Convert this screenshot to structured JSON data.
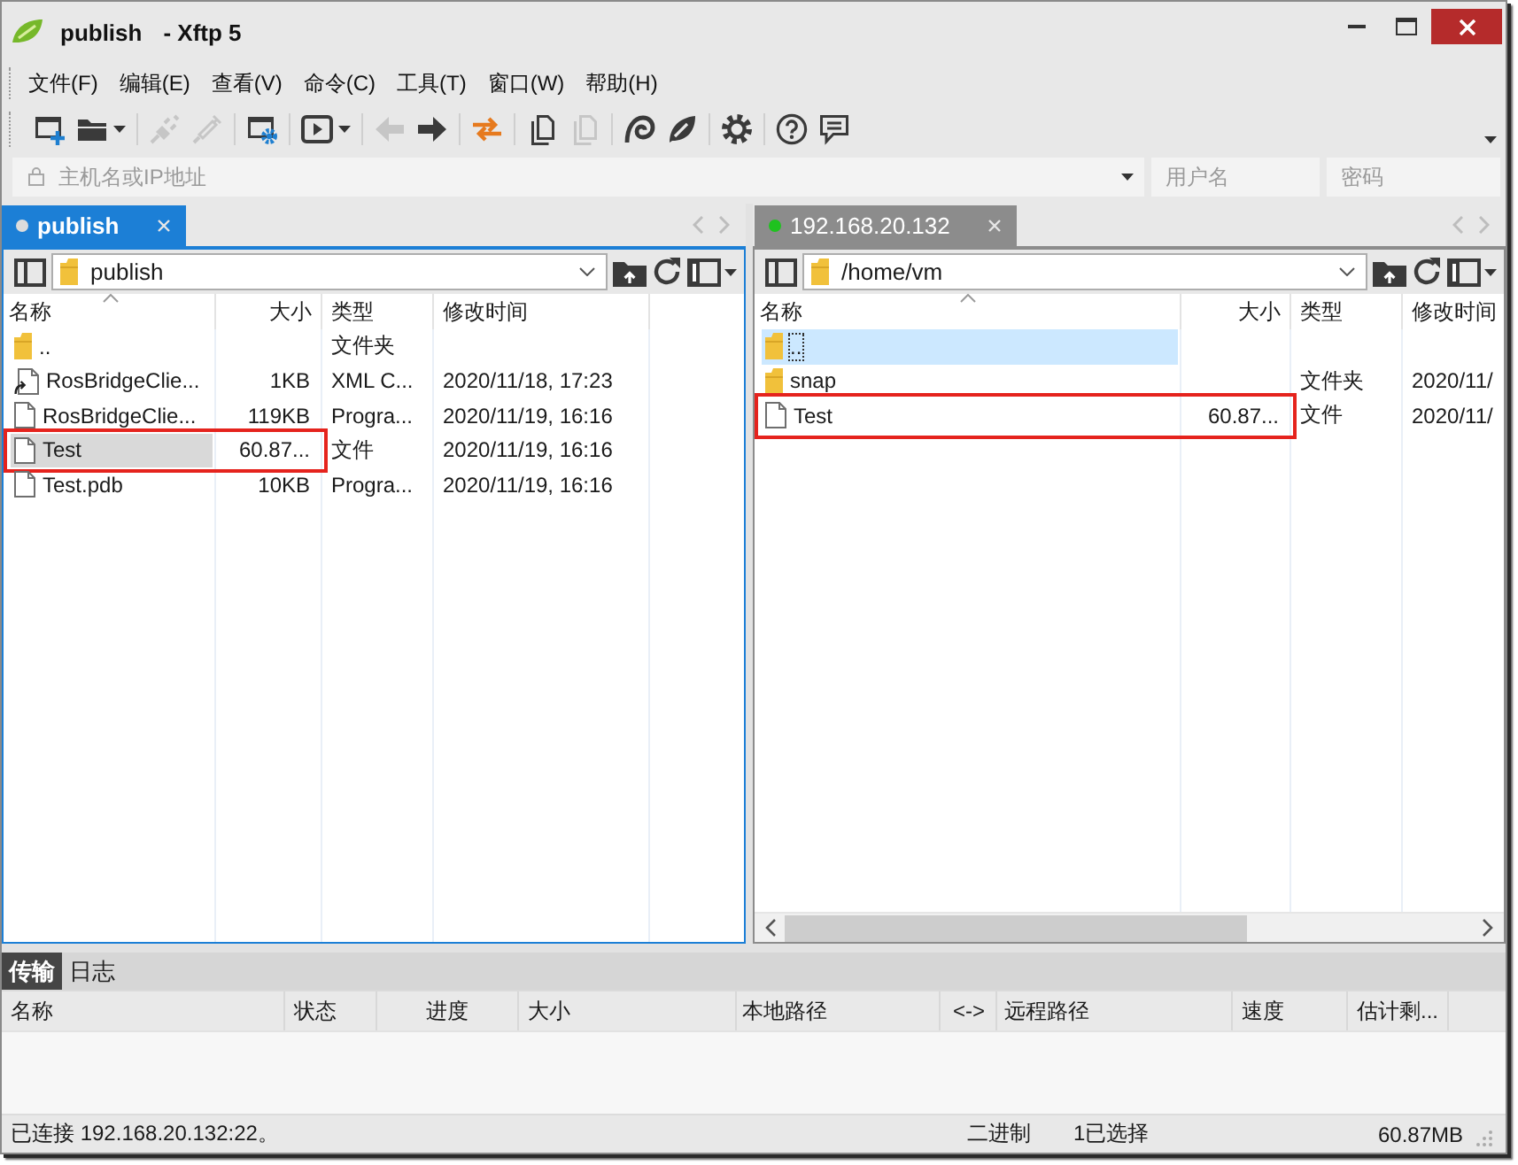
{
  "window": {
    "title": "publish",
    "app_name": "- Xftp 5"
  },
  "menu": [
    "文件(F)",
    "编辑(E)",
    "查看(V)",
    "命令(C)",
    "工具(T)",
    "窗口(W)",
    "帮助(H)"
  ],
  "toolbar": [
    [
      {
        "kind": "new-session",
        "disabled": false,
        "dropdown": false
      },
      {
        "kind": "open",
        "disabled": false,
        "dropdown": true
      }
    ],
    [
      {
        "kind": "connect",
        "disabled": true,
        "dropdown": false
      },
      {
        "kind": "disconnect",
        "disabled": true,
        "dropdown": false
      }
    ],
    [
      {
        "kind": "properties",
        "disabled": false,
        "dropdown": false
      }
    ],
    [
      {
        "kind": "run",
        "disabled": false,
        "dropdown": true
      }
    ],
    [
      {
        "kind": "back",
        "disabled": true,
        "dropdown": false
      },
      {
        "kind": "forward",
        "disabled": false,
        "dropdown": false
      }
    ],
    [
      {
        "kind": "transfer",
        "disabled": false,
        "dropdown": false
      }
    ],
    [
      {
        "kind": "copy",
        "disabled": false,
        "dropdown": false
      },
      {
        "kind": "paste",
        "disabled": true,
        "dropdown": false
      }
    ],
    [
      {
        "kind": "shell",
        "disabled": false,
        "dropdown": false
      },
      {
        "kind": "xftp",
        "disabled": false,
        "dropdown": false
      }
    ],
    [
      {
        "kind": "settings",
        "disabled": false,
        "dropdown": false
      }
    ],
    [
      {
        "kind": "help",
        "disabled": false,
        "dropdown": false
      },
      {
        "kind": "feedback",
        "disabled": false,
        "dropdown": false
      }
    ]
  ],
  "address_bar": {
    "host_placeholder": "主机名或IP地址",
    "user_placeholder": "用户名",
    "password_placeholder": "密码"
  },
  "panes": [
    {
      "focused": true,
      "tabs": [
        {
          "label": "publish",
          "selected": true,
          "connected": false
        }
      ],
      "path": "publish",
      "horizontal_scrollbar": false,
      "columns": [
        "名称",
        "大小",
        "类型",
        "修改时间"
      ],
      "rows": [
        {
          "kind": "folder",
          "name": "..",
          "type": "文件夹",
          "selected": false,
          "annotated": false
        },
        {
          "kind": "linked-file",
          "name": "RosBridgeClie...",
          "size": "1KB",
          "type": "XML C...",
          "modified": "2020/11/18, 17:23",
          "selected": false,
          "annotated": false
        },
        {
          "kind": "file",
          "name": "RosBridgeClie...",
          "size": "119KB",
          "type": "Progra...",
          "modified": "2020/11/19, 16:16",
          "selected": false,
          "annotated": false
        },
        {
          "kind": "file",
          "name": "Test",
          "size": "60.87...",
          "type": "文件",
          "modified": "2020/11/19, 16:16",
          "selected": true,
          "annotated": true
        },
        {
          "kind": "file",
          "name": "Test.pdb",
          "size": "10KB",
          "type": "Progra...",
          "modified": "2020/11/19, 16:16",
          "selected": false,
          "annotated": false
        }
      ]
    },
    {
      "focused": false,
      "tabs": [
        {
          "label": "192.168.20.132",
          "selected": false,
          "connected": true
        }
      ],
      "path": "/home/vm",
      "horizontal_scrollbar": true,
      "columns": [
        "名称",
        "大小",
        "类型",
        "修改时间"
      ],
      "rows": [
        {
          "kind": "folder",
          "name": "..",
          "selected": true,
          "annotated": false
        },
        {
          "kind": "folder",
          "name": "snap",
          "type": "文件夹",
          "modified": "2020/11/",
          "selected": false,
          "annotated": false
        },
        {
          "kind": "file",
          "name": "Test",
          "size": "60.87...",
          "type": "文件",
          "modified": "2020/11/",
          "selected": false,
          "annotated": true
        }
      ]
    }
  ],
  "bottom_tabs": [
    {
      "label": "传输",
      "selected": true
    },
    {
      "label": "日志",
      "selected": false
    }
  ],
  "transfer_columns": [
    "名称",
    "状态",
    "进度",
    "大小",
    "本地路径",
    "<->",
    "远程路径",
    "速度",
    "估计剩..."
  ],
  "status_bar": {
    "connection": "已连接 192.168.20.132:22。",
    "mode": "二进制",
    "selection": "1已选择",
    "size": "60.87MB"
  }
}
